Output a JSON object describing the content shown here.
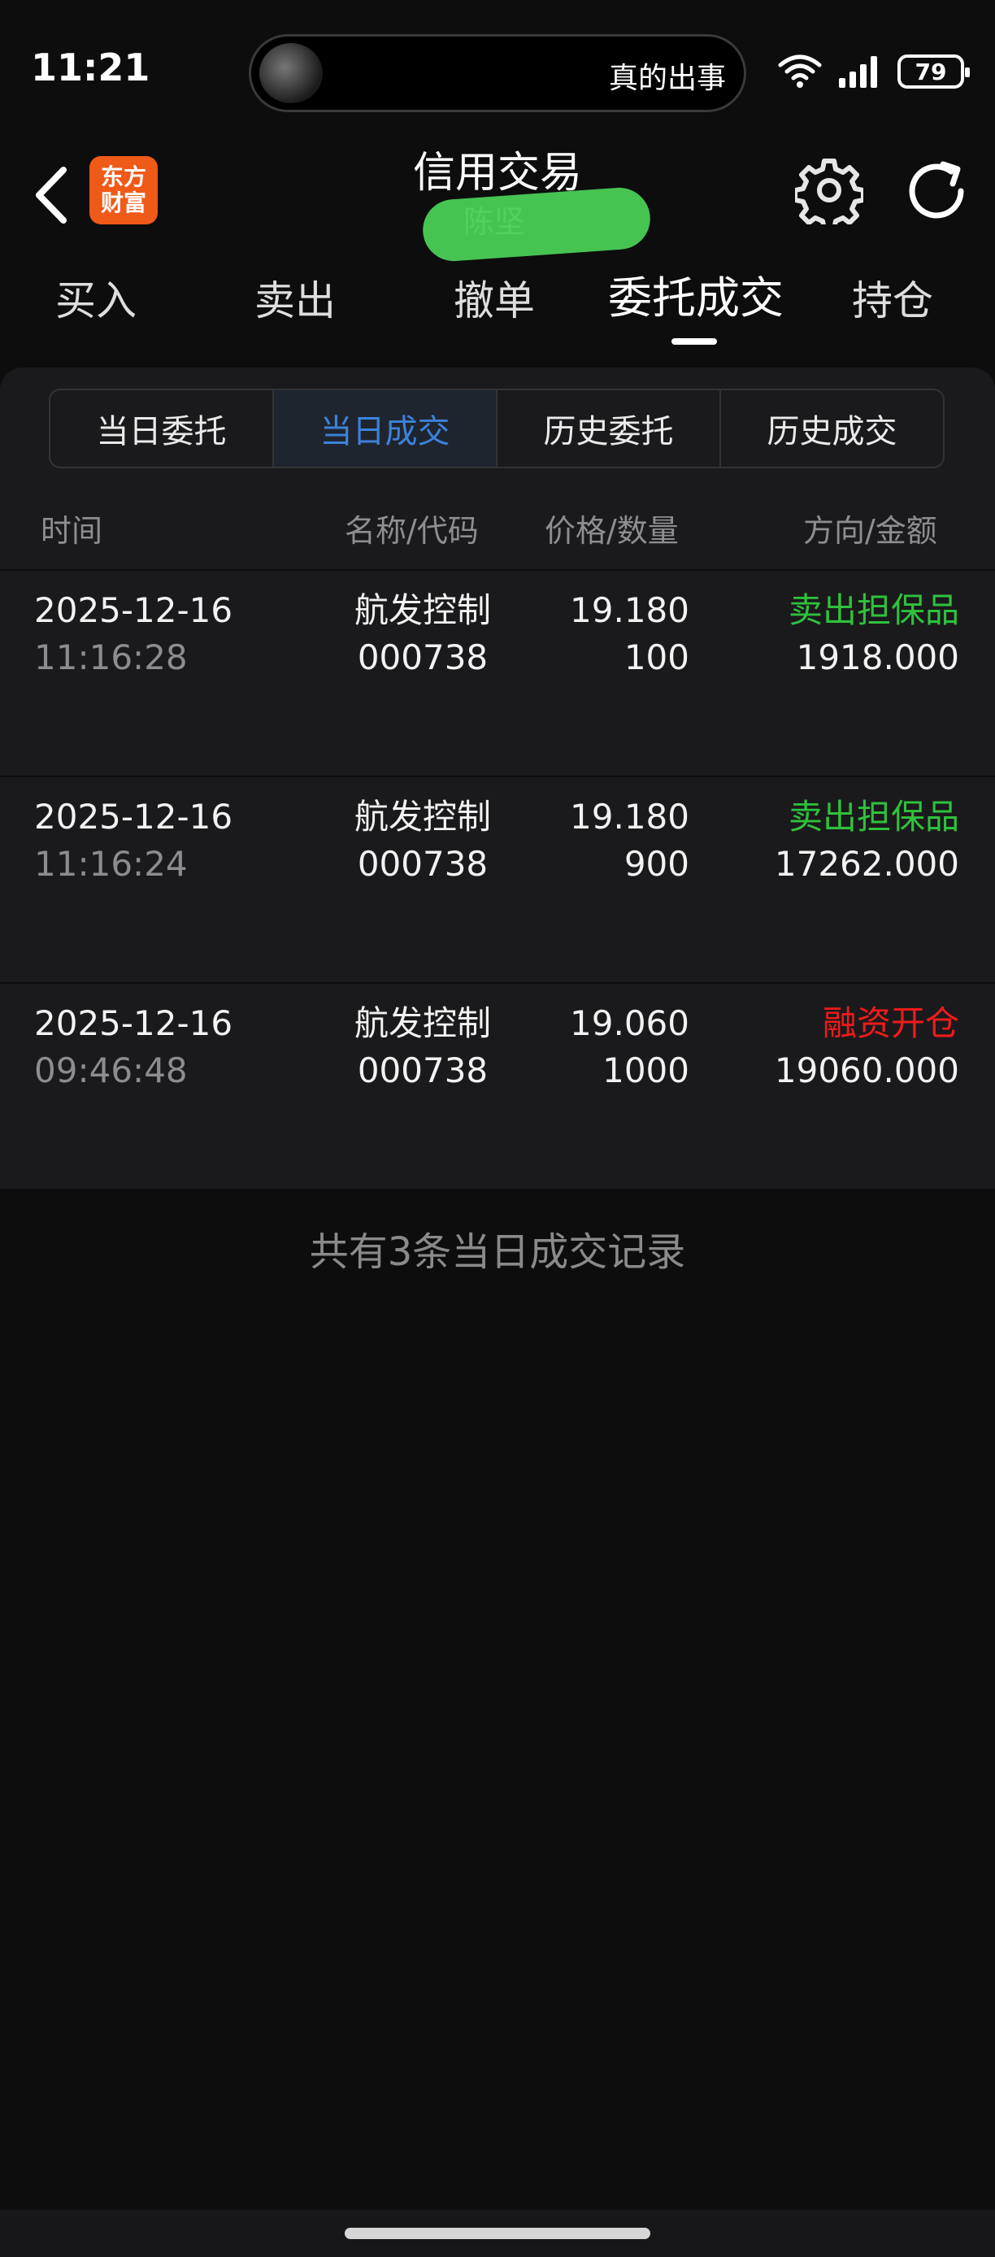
{
  "status": {
    "time": "11:21",
    "now_playing": "真的出事",
    "battery": "79"
  },
  "header": {
    "title": "信用交易",
    "account": "陈坚",
    "logo_line1": "东方",
    "logo_line2": "财富"
  },
  "main_tabs": [
    {
      "label": "买入"
    },
    {
      "label": "卖出"
    },
    {
      "label": "撤单"
    },
    {
      "label": "委托成交",
      "active": true
    },
    {
      "label": "持仓"
    }
  ],
  "sub_tabs": [
    {
      "label": "当日委托"
    },
    {
      "label": "当日成交",
      "active": true
    },
    {
      "label": "历史委托"
    },
    {
      "label": "历史成交"
    }
  ],
  "columns": {
    "time": "时间",
    "name": "名称/代码",
    "price": "价格/数量",
    "dir": "方向/金额"
  },
  "trades": [
    {
      "date": "2025-12-16",
      "time": "11:16:28",
      "name": "航发控制",
      "code": "000738",
      "price": "19.180",
      "qty": "100",
      "direction": "卖出担保品",
      "amount": "1918.000",
      "dir_color": "#2fc13c"
    },
    {
      "date": "2025-12-16",
      "time": "11:16:24",
      "name": "航发控制",
      "code": "000738",
      "price": "19.180",
      "qty": "900",
      "direction": "卖出担保品",
      "amount": "17262.000",
      "dir_color": "#2fc13c"
    },
    {
      "date": "2025-12-16",
      "time": "09:46:48",
      "name": "航发控制",
      "code": "000738",
      "price": "19.060",
      "qty": "1000",
      "direction": "融资开仓",
      "amount": "19060.000",
      "dir_color": "#f01a1a"
    }
  ],
  "footer_note": "共有3条当日成交记录",
  "colors": {
    "accent": "#3c82da",
    "sell": "#2fc13c",
    "buy": "#f01a1a",
    "brand": "#f05a19"
  }
}
